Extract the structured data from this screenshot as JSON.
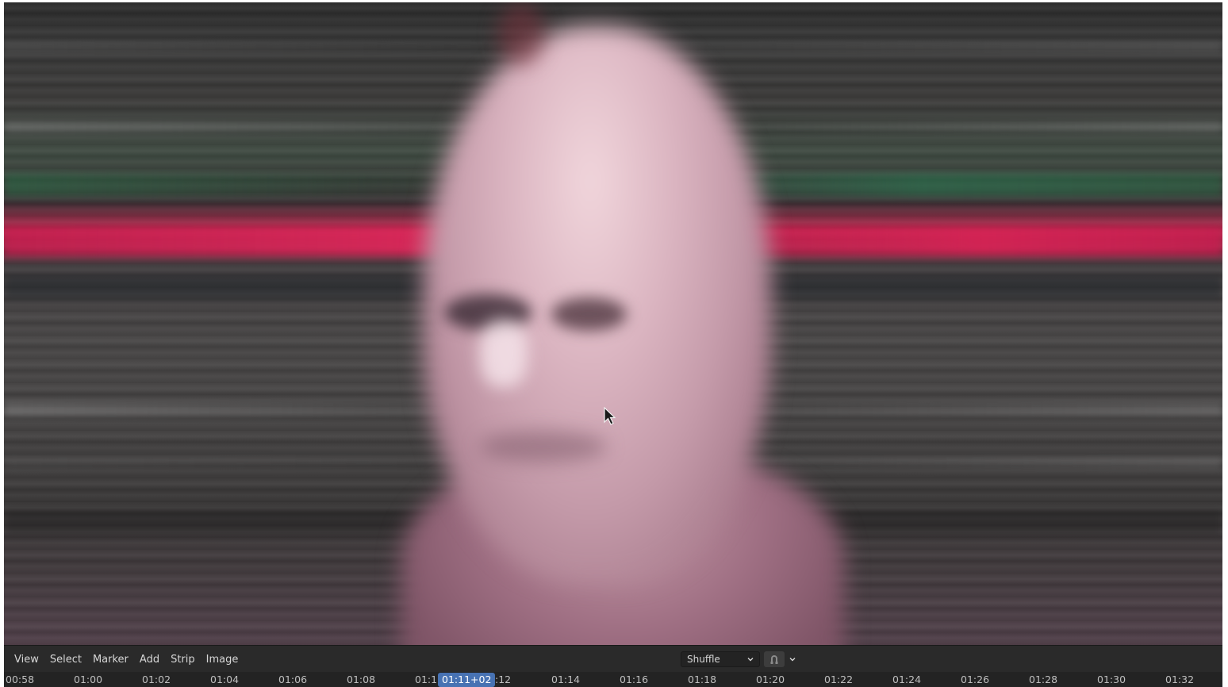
{
  "menu": {
    "items": [
      "View",
      "Select",
      "Marker",
      "Add",
      "Strip",
      "Image"
    ]
  },
  "overlap_mode": {
    "value": "Shuffle",
    "icon": "chevron-down-icon"
  },
  "snapping": {
    "icon": "snap-icon"
  },
  "timeline": {
    "ticks": [
      "00:58",
      "01:00",
      "01:02",
      "01:04",
      "01:06",
      "01:08",
      "01:1",
      ":12",
      "01:14",
      "01:16",
      "01:18",
      "01:20",
      "01:22",
      "01:24",
      "01:26",
      "01:28",
      "01:30",
      "01:32"
    ],
    "current_frame": "01:11+02"
  },
  "colors": {
    "accent": "#4772b3",
    "header_bg": "#2a2a2a",
    "ruler_bg": "#232323",
    "text": "#d6d6d6"
  }
}
